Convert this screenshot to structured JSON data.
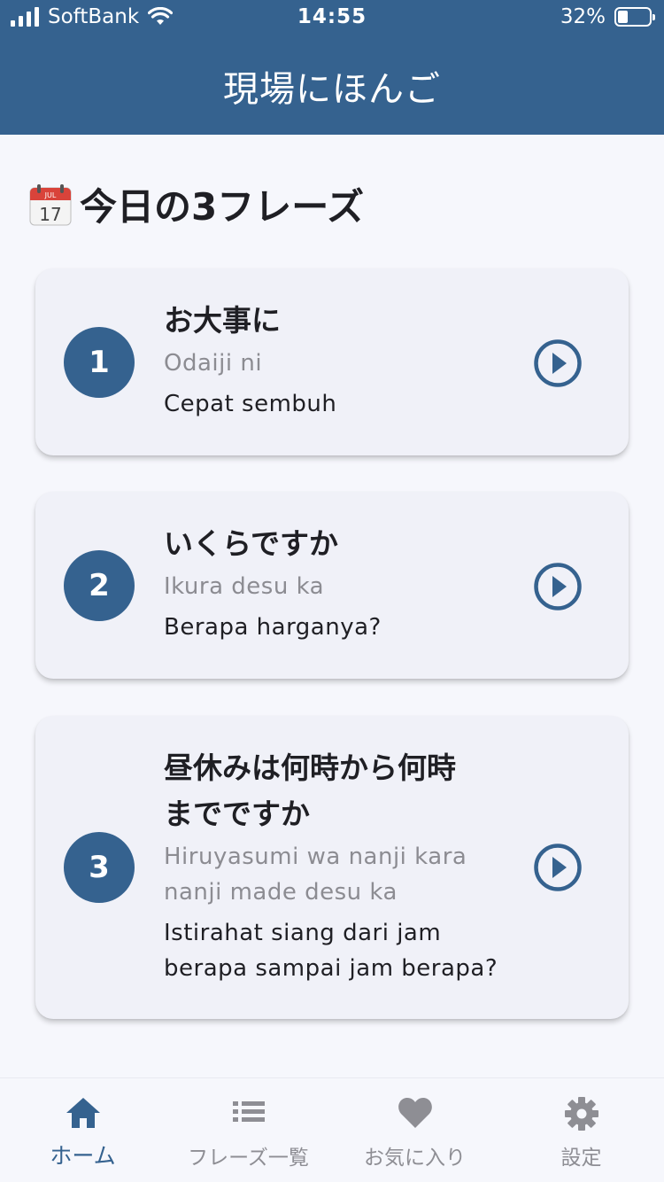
{
  "status_bar": {
    "carrier": "SoftBank",
    "time": "14:55",
    "battery": "32%",
    "battery_level": 0.32
  },
  "header": {
    "title": "現場にほんご"
  },
  "section": {
    "icon": "calendar-icon",
    "calendar_month": "JUL",
    "calendar_day": "17",
    "title": "今日の3フレーズ"
  },
  "phrases": [
    {
      "number": "1",
      "japanese": "お大事に",
      "romaji": "Odaiji ni",
      "translation": "Cepat sembuh"
    },
    {
      "number": "2",
      "japanese": "いくらですか",
      "romaji": "Ikura desu ka",
      "translation": "Berapa harganya?"
    },
    {
      "number": "3",
      "japanese_line1": "昼休みは何時から何時",
      "japanese_line2": "までですか",
      "romaji_line1": "Hiruyasumi wa nanji kara",
      "romaji_line2": "nanji made desu ka",
      "translation_line1": "Istirahat siang dari jam",
      "translation_line2": "berapa sampai jam berapa?"
    }
  ],
  "tabs": [
    {
      "label": "ホーム",
      "icon": "home-icon",
      "active": true
    },
    {
      "label": "フレーズ一覧",
      "icon": "list-icon",
      "active": false
    },
    {
      "label": "お気に入り",
      "icon": "heart-icon",
      "active": false
    },
    {
      "label": "設定",
      "icon": "gear-icon",
      "active": false
    }
  ],
  "colors": {
    "primary": "#35628f",
    "background": "#f6f7fc",
    "card": "#f0f1f8",
    "muted": "#8e8e94"
  }
}
